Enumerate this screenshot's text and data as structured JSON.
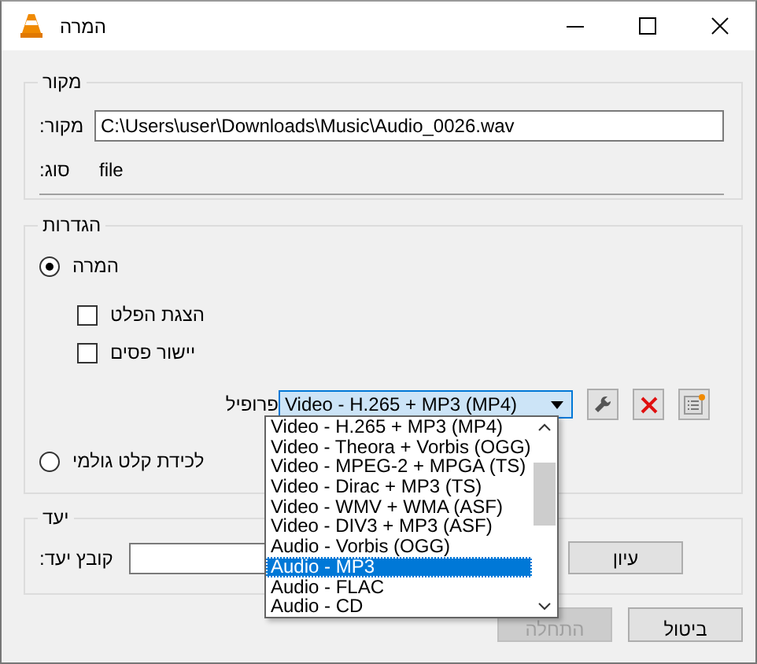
{
  "window": {
    "title": "המרה"
  },
  "source": {
    "title": "מקור",
    "label": "מקור:",
    "value": "C:\\Users\\user\\Downloads\\Music\\Audio_0026.wav",
    "type_label": "סוג:",
    "type_value": "file"
  },
  "settings": {
    "title": "הגדרות",
    "modes": [
      {
        "label": "המרה",
        "selected": true
      },
      {
        "label": "לכידת קלט גולמי",
        "selected": false
      }
    ],
    "options": [
      {
        "label": "הצגת הפלט",
        "checked": false
      },
      {
        "label": "יישור פסים",
        "checked": false
      }
    ],
    "profile_label": "פרופיל",
    "profile_value": "Video - H.265 + MP3 (MP4)",
    "profile_expanded": true,
    "profile_items": [
      {
        "label": "Video - H.265 + MP3 (MP4)",
        "selected": false
      },
      {
        "label": "Video - Theora + Vorbis (OGG)",
        "selected": false
      },
      {
        "label": "Video - MPEG-2 + MPGA (TS)",
        "selected": false
      },
      {
        "label": "Video - Dirac + MP3 (TS)",
        "selected": false
      },
      {
        "label": "Video - WMV + WMA (ASF)",
        "selected": false
      },
      {
        "label": "Video - DIV3 + MP3 (ASF)",
        "selected": false
      },
      {
        "label": "Audio - Vorbis (OGG)",
        "selected": false
      },
      {
        "label": "Audio - MP3",
        "selected": true
      },
      {
        "label": "Audio - FLAC",
        "selected": false
      },
      {
        "label": "Audio - CD",
        "selected": false
      }
    ]
  },
  "destination": {
    "title": "יעד",
    "label": "קובץ יעד:",
    "browse": "עיון"
  },
  "buttons": [
    {
      "label": "ביטול",
      "disabled": false
    },
    {
      "label": "התחלה",
      "disabled": true
    }
  ]
}
